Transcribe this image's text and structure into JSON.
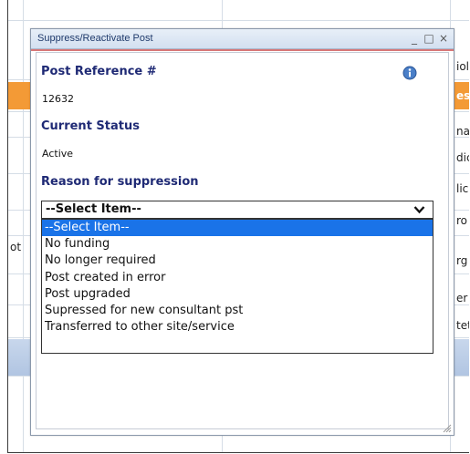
{
  "background": {
    "left_text": "ot",
    "right_texts": [
      "iol",
      "es",
      "na",
      "dic",
      "lic",
      "ro",
      "rg",
      "er",
      "tet"
    ]
  },
  "dialog": {
    "title": "Suppress/Reactivate Post",
    "controls": {
      "minimize": "_",
      "maximize": "□",
      "close": "×"
    },
    "post_reference_label": "Post Reference #",
    "post_reference_value": "12632",
    "current_status_label": "Current Status",
    "current_status_value": "Active",
    "reason_label": "Reason for suppression",
    "reason_select": {
      "selected": "--Select Item--",
      "options": [
        "--Select Item--",
        "No funding",
        "No longer required",
        "Post created in error",
        "Post upgraded",
        "Supressed for new consultant pst",
        "Transferred to other site/service"
      ],
      "highlighted_index": 0
    }
  },
  "colors": {
    "accent": "#f39a36",
    "label": "#1f2a75",
    "highlight": "#1a73e8"
  }
}
